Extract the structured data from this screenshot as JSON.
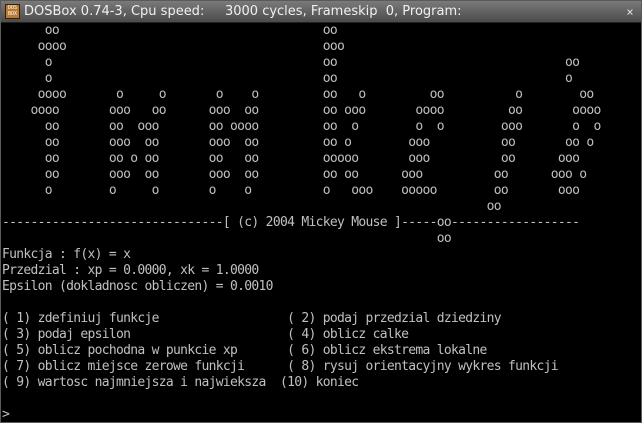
{
  "window": {
    "title": "DOSBox 0.74-3, Cpu speed:     3000 cycles, Frameskip  0, Program:",
    "icon_text": "DOS\nBOX",
    "close_glyph": "×"
  },
  "screen": {
    "lines": [
      "      oo                                     oo",
      "     oooo                                    ooo",
      "      o                                      oo                                oo",
      "      o                                      oo                                o",
      "     oooo       o     o       o    o         oo   o         oo          o        oo",
      "    oooo       ooo   oo      ooo  oo         oo ooo       oooo         oo       oooo",
      "      oo       oo  ooo       oo oooo         oo  o        o  o        ooo       o  o",
      "      oo       ooo  oo       ooo  oo         oo o        ooo          oo       oo o",
      "      oo       oo o oo       oo   oo         ooooo       ooo          oo      ooo",
      "      oo       ooo  oo       ooo  oo         oo oo      ooo          oo      ooo o",
      "      o        o     o       o    o          o   ooo    ooooo        oo       ooo",
      "                                                                    oo",
      "-------------------------------[ (c) 2004 Mickey Mouse ]-----oo------------------",
      "                                                             oo",
      "Funkcja : f(x) = x",
      "Przedzial : xp = 0.0000, xk = 1.0000",
      "Epsilon (dokladnosc obliczen) = 0.0010",
      "",
      "( 1) zdefiniuj funkcje                  ( 2) podaj przedzial dziedziny",
      "( 3) podaj epsilon                      ( 4) oblicz calke",
      "( 5) oblicz pochodna w punkcie xp       ( 6) oblicz ekstrema lokalne",
      "( 7) oblicz miejsce zerowe funkcji      ( 8) rysuj orientacyjny wykres funkcji",
      "( 9) wartosc najmniejsza i najwieksza  (10) koniec",
      "",
      ">"
    ]
  }
}
